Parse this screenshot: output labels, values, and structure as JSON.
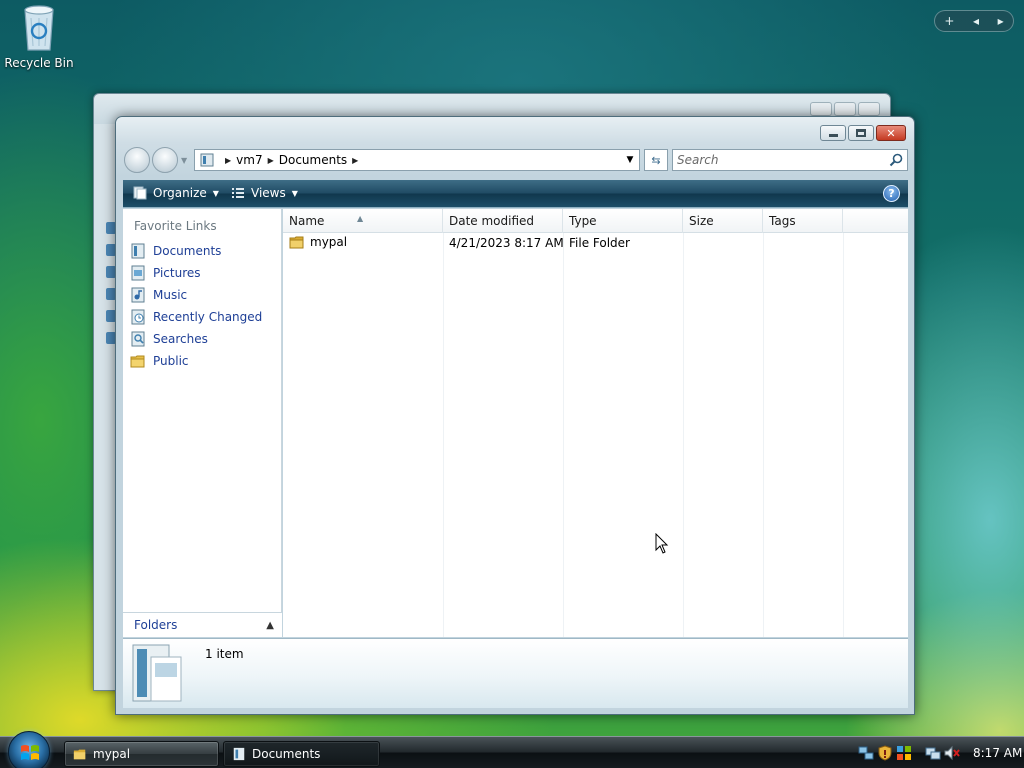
{
  "desktop": {
    "icons": [
      {
        "label": "Recycle Bin",
        "icon": "recycle-bin-icon"
      }
    ],
    "gadget_bar": {
      "add": "+",
      "prev": "◂",
      "next": "▸"
    }
  },
  "window": {
    "title": "Documents",
    "address": {
      "crumbs": [
        "vm7",
        "Documents"
      ]
    },
    "search": {
      "placeholder": "Search"
    },
    "toolbar": {
      "organize": "Organize",
      "views": "Views",
      "help": "?"
    },
    "nav_pane": {
      "header": "Favorite Links",
      "links": [
        {
          "label": "Documents",
          "icon": "documents-icon"
        },
        {
          "label": "Pictures",
          "icon": "pictures-icon"
        },
        {
          "label": "Music",
          "icon": "music-icon"
        },
        {
          "label": "Recently Changed",
          "icon": "recently-changed-icon"
        },
        {
          "label": "Searches",
          "icon": "searches-icon"
        },
        {
          "label": "Public",
          "icon": "public-folder-icon"
        }
      ],
      "folders_label": "Folders"
    },
    "columns": [
      "Name",
      "Date modified",
      "Type",
      "Size",
      "Tags"
    ],
    "rows": [
      {
        "name": "mypal",
        "date_modified": "4/21/2023 8:17 AM",
        "type": "File Folder",
        "size": "",
        "tags": ""
      }
    ],
    "status": {
      "count": "1 item"
    }
  },
  "taskbar": {
    "buttons": [
      {
        "label": "mypal",
        "icon": "folder-icon",
        "active": false
      },
      {
        "label": "Documents",
        "icon": "documents-icon",
        "active": true
      }
    ],
    "clock": "8:17 AM"
  },
  "colors": {
    "link": "#1e3f96",
    "folder": "#e8c04a",
    "cmdbar": "#1f4a63"
  }
}
